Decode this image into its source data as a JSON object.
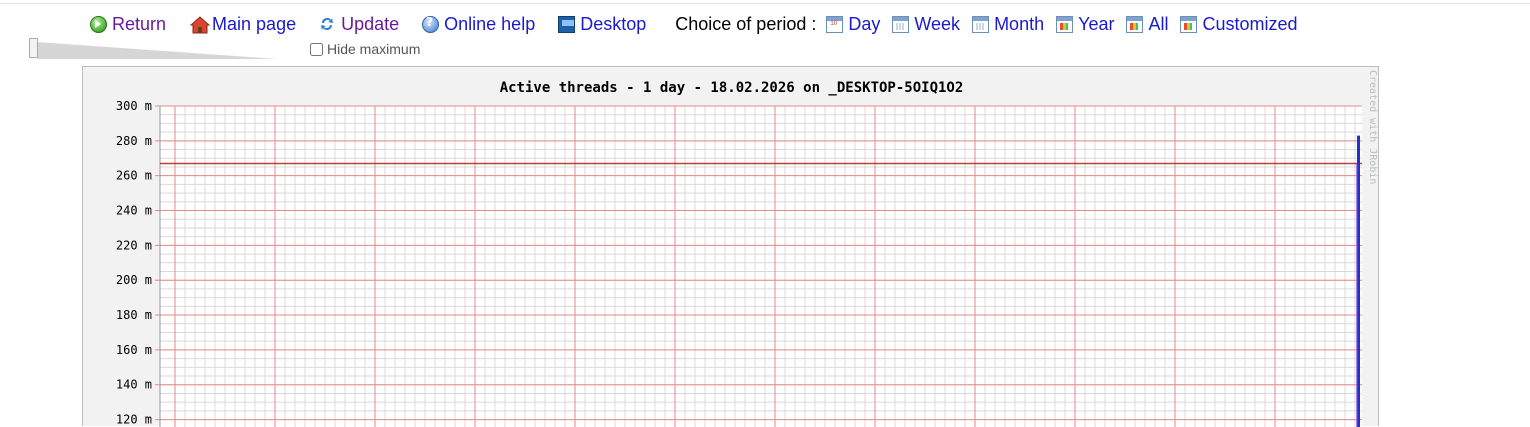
{
  "toolbar": {
    "return_label": "Return",
    "main_page_label": "Main page",
    "update_label": "Update",
    "online_help_label": "Online help",
    "desktop_label": "Desktop",
    "period_label": "Choice of period :",
    "periods": [
      "Day",
      "Week",
      "Month",
      "Year",
      "All",
      "Customized"
    ]
  },
  "controls": {
    "hide_maximum_label": "Hide maximum",
    "hide_maximum_checked": false
  },
  "chart": {
    "title": "Active threads - 1 day - 18.02.2026 on _DESKTOP-5OIQ1O2",
    "watermark": "Created with JRobin"
  },
  "chart_data": {
    "type": "line",
    "title": "Active threads - 1 day - 18.02.2026 on _DESKTOP-5OIQ1O2",
    "xlabel": "",
    "ylabel": "",
    "y_ticks": [
      "300 m",
      "280 m",
      "260 m",
      "240 m",
      "220 m",
      "200 m",
      "180 m",
      "160 m",
      "140 m",
      "120 m"
    ],
    "ylim": [
      110,
      300
    ],
    "grid": true,
    "series": [
      {
        "color": "#1f2fd6",
        "x": [
          0.9965,
          0.9975,
          1.0
        ],
        "values": [
          0,
          283,
          283
        ]
      }
    ],
    "reference_lines": [
      {
        "value": 267,
        "color": "#c23b3b"
      }
    ]
  },
  "colors": {
    "link": "#1a1ad0",
    "visited": "#6a1b9a",
    "grid_major": "#e88a8a",
    "grid_minor": "#d9d9d9",
    "max_line": "#c23b3b",
    "series": "#1f2fd6"
  }
}
